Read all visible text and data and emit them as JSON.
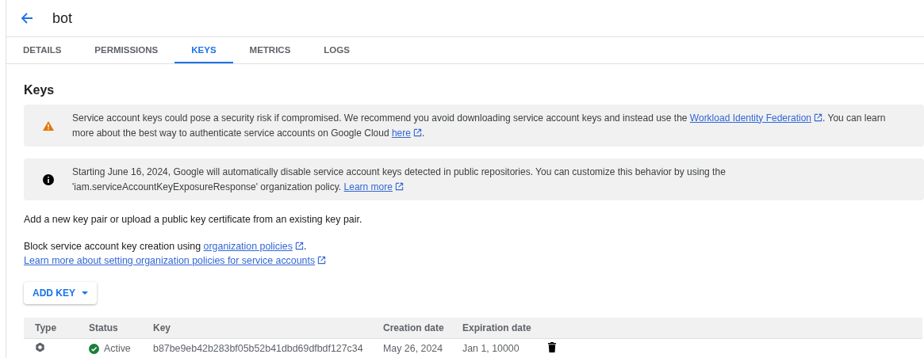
{
  "header": {
    "title": "bot"
  },
  "tabs": [
    {
      "label": "DETAILS",
      "selected": false
    },
    {
      "label": "PERMISSIONS",
      "selected": false
    },
    {
      "label": "KEYS",
      "selected": true
    },
    {
      "label": "METRICS",
      "selected": false
    },
    {
      "label": "LOGS",
      "selected": false
    }
  ],
  "section_title": "Keys",
  "notices": [
    {
      "kind": "warning",
      "segments": [
        {
          "kind": "text",
          "text": "Service account keys could pose a security risk if compromised. We recommend you avoid downloading service account keys and instead use the "
        },
        {
          "kind": "link",
          "text": "Workload Identity Federation"
        },
        {
          "kind": "text",
          "text": ". You can learn more about the best way to authenticate service accounts on Google Cloud "
        },
        {
          "kind": "link",
          "text": "here"
        },
        {
          "kind": "text",
          "text": "."
        }
      ]
    },
    {
      "kind": "info",
      "segments": [
        {
          "kind": "text",
          "text": "Starting June 16, 2024, Google will automatically disable service account keys detected in public repositories. You can customize this behavior by using the 'iam.serviceAccountKeyExposureResponse' organization policy. "
        },
        {
          "kind": "link",
          "text": "Learn more"
        }
      ]
    }
  ],
  "intro": "Add a new key pair or upload a public key certificate from an existing key pair.",
  "policy_lines": [
    {
      "segments": [
        {
          "kind": "text",
          "text": "Block service account key creation using "
        },
        {
          "kind": "link",
          "text": "organization policies"
        },
        {
          "kind": "text",
          "text": "."
        }
      ]
    },
    {
      "segments": [
        {
          "kind": "link",
          "text": "Learn more about setting organization policies for service accounts"
        }
      ]
    }
  ],
  "add_key_button": "ADD KEY",
  "table": {
    "columns": [
      "Type",
      "Status",
      "Key",
      "Creation date",
      "Expiration date"
    ],
    "rows": [
      {
        "status": "Active",
        "key": "b87be9eb42b283bf05b52b41dbd69dfbdf127c34",
        "creation_date": "May 26, 2024",
        "expiration_date": "Jan 1, 10000"
      }
    ]
  }
}
